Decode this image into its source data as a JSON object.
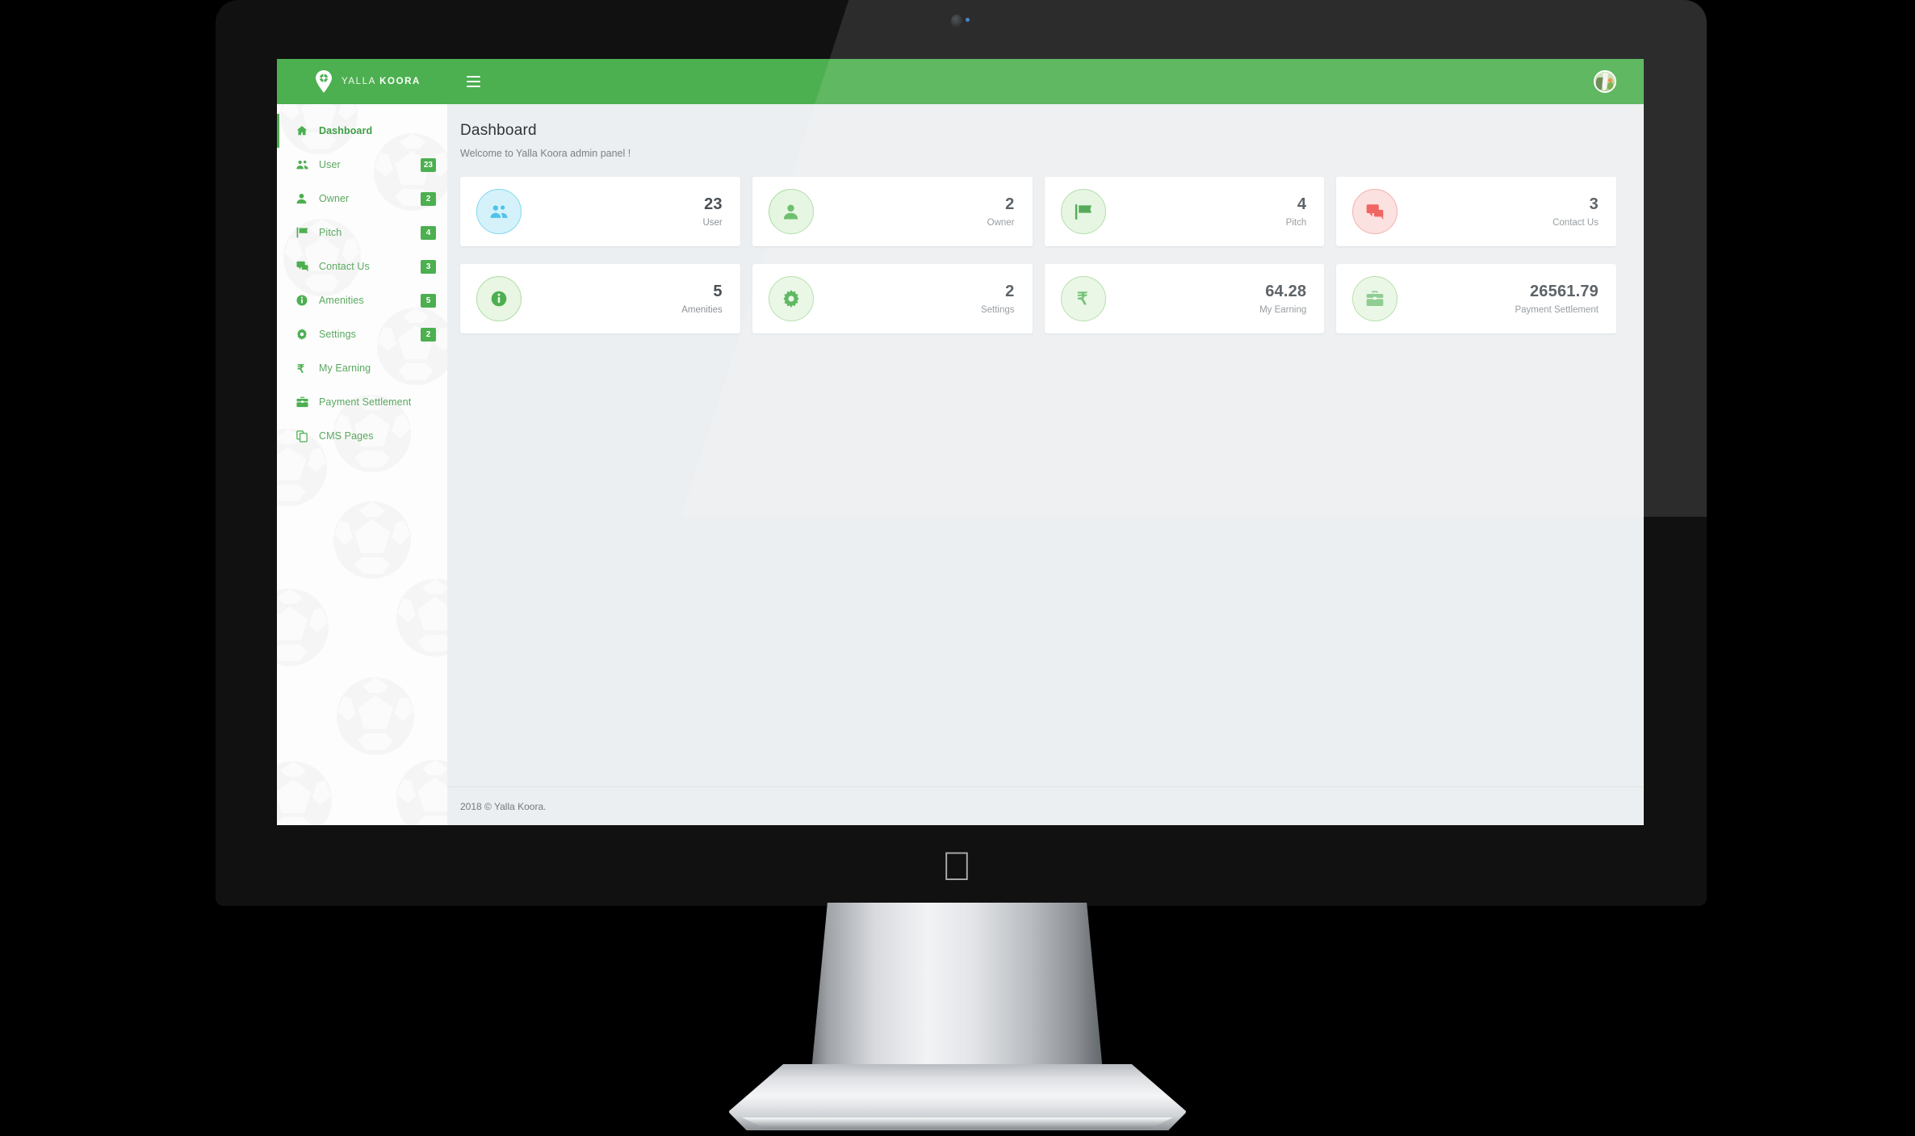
{
  "brand": {
    "name_light": "YALLA",
    "name_bold": "KOORA",
    "logo_icon": "map-pin-soccer-icon"
  },
  "topbar": {
    "menu_toggle_icon": "hamburger-icon",
    "avatar_icon": "user-avatar"
  },
  "sidebar": {
    "items": [
      {
        "label": "Dashboard",
        "icon": "home-icon",
        "badge": "",
        "active": true
      },
      {
        "label": "User",
        "icon": "users-icon",
        "badge": "23",
        "active": false
      },
      {
        "label": "Owner",
        "icon": "person-icon",
        "badge": "2",
        "active": false
      },
      {
        "label": "Pitch",
        "icon": "flag-icon",
        "badge": "4",
        "active": false
      },
      {
        "label": "Contact Us",
        "icon": "chat-icon",
        "badge": "3",
        "active": false
      },
      {
        "label": "Amenities",
        "icon": "info-icon",
        "badge": "5",
        "active": false
      },
      {
        "label": "Settings",
        "icon": "gear-icon",
        "badge": "2",
        "active": false
      },
      {
        "label": "My Earning",
        "icon": "rupee-icon",
        "badge": "",
        "active": false
      },
      {
        "label": "Payment Settlement",
        "icon": "briefcase-icon",
        "badge": "",
        "active": false
      },
      {
        "label": "CMS Pages",
        "icon": "pages-icon",
        "badge": "",
        "active": false
      }
    ]
  },
  "main": {
    "title": "Dashboard",
    "subtitle": "Welcome to Yalla Koora admin panel !",
    "cards_row_1": [
      {
        "value": "23",
        "label": "User",
        "icon": "users-icon",
        "circle_bg": "#d5f2fb",
        "circle_border": "#7fd8ef",
        "icon_color": "#4fc3e8"
      },
      {
        "value": "2",
        "label": "Owner",
        "icon": "person-icon",
        "circle_bg": "#e4f5e0",
        "circle_border": "#a9dba0",
        "icon_color": "#5cb85c"
      },
      {
        "value": "4",
        "label": "Pitch",
        "icon": "flag-icon",
        "circle_bg": "#e4f5e0",
        "circle_border": "#a9dba0",
        "icon_color": "#43a047"
      },
      {
        "value": "3",
        "label": "Contact Us",
        "icon": "chat-icon",
        "circle_bg": "#fbdedd",
        "circle_border": "#f0a9a6",
        "icon_color": "#ef5350"
      }
    ],
    "cards_row_2": [
      {
        "value": "5",
        "label": "Amenities",
        "icon": "info-icon",
        "circle_bg": "#e8f6e3",
        "circle_border": "#aedda3",
        "icon_color": "#4caf50"
      },
      {
        "value": "2",
        "label": "Settings",
        "icon": "gear-icon",
        "circle_bg": "#e8f6e3",
        "circle_border": "#aedda3",
        "icon_color": "#4caf50"
      },
      {
        "value": "64.28",
        "label": "My Earning",
        "icon": "rupee-icon",
        "circle_bg": "#e8f6e3",
        "circle_border": "#aedda3",
        "icon_color": "#66bb6a"
      },
      {
        "value": "26561.79",
        "label": "Payment Settlement",
        "icon": "briefcase-icon",
        "circle_bg": "#e8f6e3",
        "circle_border": "#aedda3",
        "icon_color": "#81c784"
      }
    ]
  },
  "footer": {
    "text": "2018 © Yalla Koora."
  },
  "colors": {
    "brand_green": "#4caf50",
    "screen_bg": "#eceff1",
    "sidebar_bg": "#fdfdfd",
    "card_bg": "#ffffff"
  }
}
